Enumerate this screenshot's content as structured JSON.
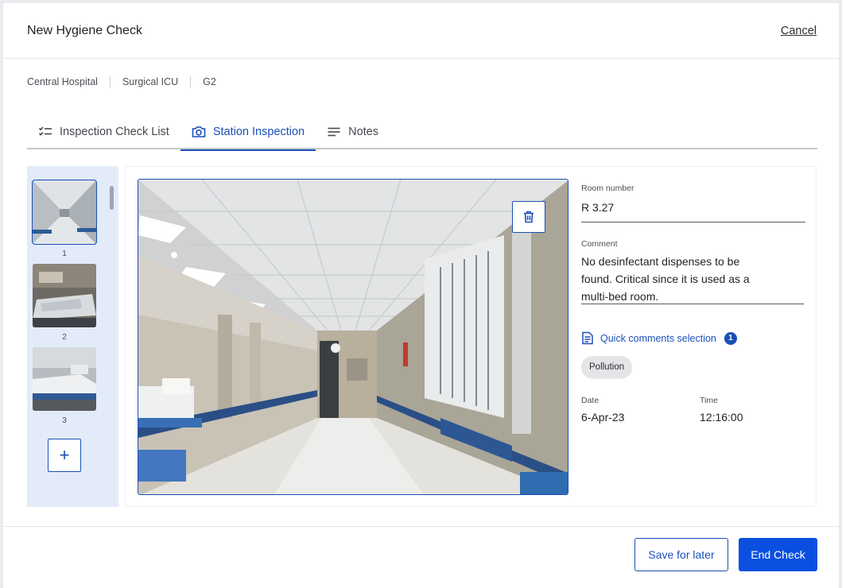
{
  "dialog": {
    "title": "New Hygiene Check",
    "cancel_label": "Cancel"
  },
  "breadcrumb": [
    "Central Hospital",
    "Surgical ICU",
    "G2"
  ],
  "tabs": [
    {
      "label": "Inspection Check List",
      "icon": "checklist-icon",
      "active": false
    },
    {
      "label": "Station Inspection",
      "icon": "camera-icon",
      "active": true
    },
    {
      "label": "Notes",
      "icon": "notes-icon",
      "active": false
    }
  ],
  "thumbnails": [
    {
      "label": "1",
      "selected": true
    },
    {
      "label": "2",
      "selected": false
    },
    {
      "label": "3",
      "selected": false
    }
  ],
  "add_photo_label": "+",
  "form": {
    "room_label": "Room number",
    "room_value": "R 3.27",
    "comment_label": "Comment",
    "comment_value": "No desinfectant dispenses to be found. Critical since it is used as a multi-bed room.",
    "quick_comments_label": "Quick comments selection",
    "quick_comments_count": "1",
    "chip": "Pollution",
    "date_label": "Date",
    "date_value": "6-Apr-23",
    "time_label": "Time",
    "time_value": "12:16:00"
  },
  "footer": {
    "save_label": "Save for later",
    "end_label": "End Check"
  },
  "colors": {
    "accent": "#1a4fb8",
    "primary_button": "#0a4fe0",
    "thumb_panel": "#e3ebf9"
  }
}
